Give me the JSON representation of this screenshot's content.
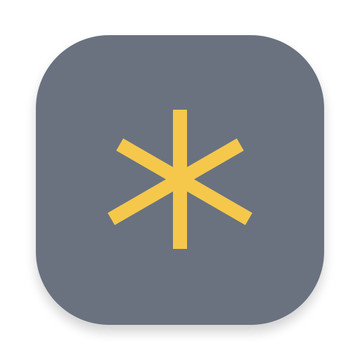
{
  "icon": {
    "name": "asterisk-icon",
    "colors": {
      "tile": "#6b7280",
      "glyph": "#f5c84c",
      "shadow": "#000000"
    }
  }
}
